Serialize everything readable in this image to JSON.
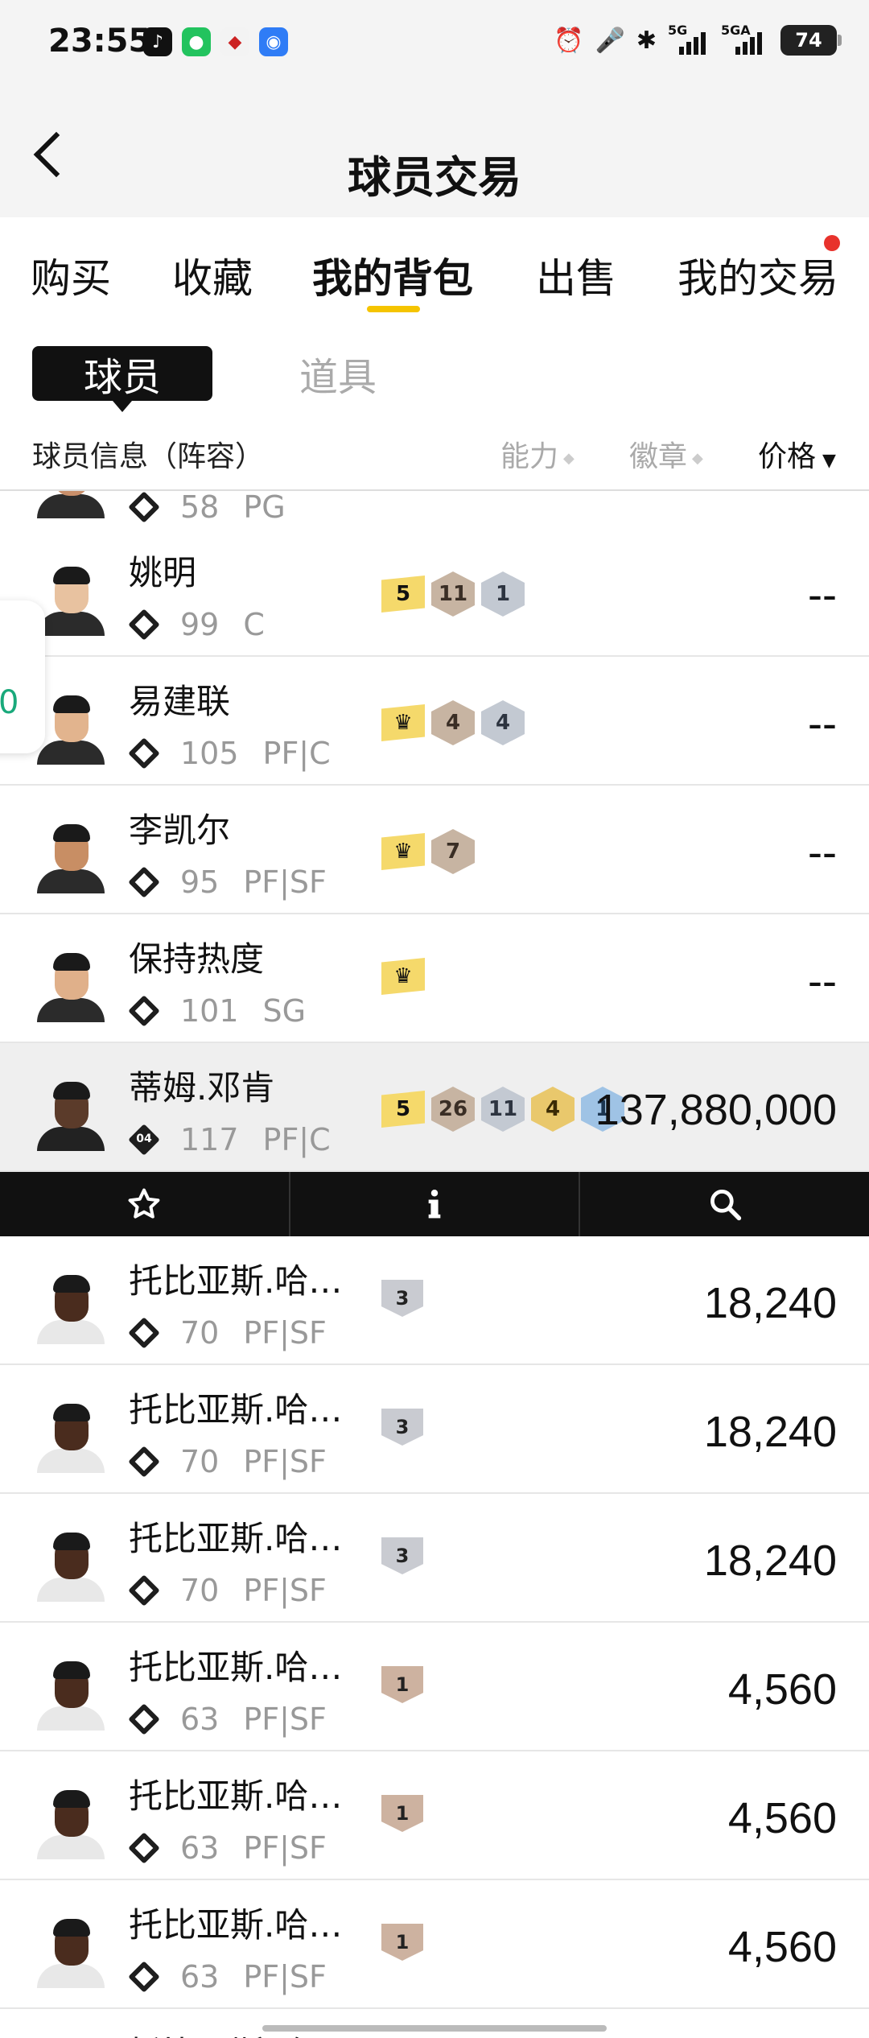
{
  "status_bar": {
    "time": "23:55",
    "apps": [
      "tiktok-icon",
      "wechat-icon",
      "game-app-icon",
      "radio-icon"
    ],
    "network_1": "5G",
    "network_2": "5GA",
    "battery": "74"
  },
  "header": {
    "title": "球员交易"
  },
  "tabs": [
    {
      "label": "购买"
    },
    {
      "label": "收藏"
    },
    {
      "label": "我的背包",
      "active": true
    },
    {
      "label": "出售"
    },
    {
      "label": "我的交易",
      "has_dot": true
    }
  ],
  "segments": {
    "player": "球员",
    "item": "道具"
  },
  "columns": {
    "info": "球员信息（阵容）",
    "ability": "能力",
    "badge": "徽章",
    "price": "价格"
  },
  "side_tab_text": "0",
  "players": [
    {
      "name": "",
      "rating": "58",
      "position": "PG",
      "price": "",
      "skin": "#c98f6a"
    },
    {
      "name": "姚明",
      "rating": "99",
      "position": "C",
      "price": "--",
      "skin": "#e8c2a0",
      "badges": [
        {
          "kind": "lvl",
          "v": "5"
        },
        {
          "kind": "bronze",
          "v": "11"
        },
        {
          "kind": "silver",
          "v": "1"
        }
      ]
    },
    {
      "name": "易建联",
      "rating": "105",
      "position": "PF|C",
      "price": "--",
      "skin": "#e2b48e",
      "badges": [
        {
          "kind": "crown",
          "v": "♛"
        },
        {
          "kind": "bronze",
          "v": "4"
        },
        {
          "kind": "silver",
          "v": "4"
        }
      ]
    },
    {
      "name": "李凯尔",
      "rating": "95",
      "position": "PF|SF",
      "price": "--",
      "skin": "#c88e64",
      "badges": [
        {
          "kind": "crown",
          "v": "♛"
        },
        {
          "kind": "bronze",
          "v": "7"
        }
      ]
    },
    {
      "name": "保持热度",
      "rating": "101",
      "position": "SG",
      "price": "--",
      "skin": "#e0b08a",
      "badges": [
        {
          "kind": "crown",
          "v": "♛"
        }
      ]
    },
    {
      "name": "蒂姆.邓肯",
      "rating": "117",
      "position": "PF|C",
      "price": "137,880,000",
      "skin": "#5b3b2a",
      "rank_label": "04",
      "badges": [
        {
          "kind": "lvl",
          "v": "5"
        },
        {
          "kind": "bronze",
          "v": "26"
        },
        {
          "kind": "silver",
          "v": "11"
        },
        {
          "kind": "gold",
          "v": "4"
        },
        {
          "kind": "blue",
          "v": "1"
        }
      ]
    },
    {
      "name": "托比亚斯.哈…",
      "rating": "70",
      "position": "PF|SF",
      "price": "18,240",
      "skin": "#4a2c1e",
      "badges": [
        {
          "kind": "shield-silver",
          "v": "3"
        }
      ]
    },
    {
      "name": "托比亚斯.哈…",
      "rating": "70",
      "position": "PF|SF",
      "price": "18,240",
      "skin": "#4a2c1e",
      "badges": [
        {
          "kind": "shield-silver",
          "v": "3"
        }
      ]
    },
    {
      "name": "托比亚斯.哈…",
      "rating": "70",
      "position": "PF|SF",
      "price": "18,240",
      "skin": "#4a2c1e",
      "badges": [
        {
          "kind": "shield-silver",
          "v": "3"
        }
      ]
    },
    {
      "name": "托比亚斯.哈…",
      "rating": "63",
      "position": "PF|SF",
      "price": "4,560",
      "skin": "#4a2c1e",
      "badges": [
        {
          "kind": "shield-bronze",
          "v": "1"
        }
      ]
    },
    {
      "name": "托比亚斯.哈…",
      "rating": "63",
      "position": "PF|SF",
      "price": "4,560",
      "skin": "#4a2c1e",
      "badges": [
        {
          "kind": "shield-bronze",
          "v": "1"
        }
      ]
    },
    {
      "name": "托比亚斯.哈…",
      "rating": "63",
      "position": "PF|SF",
      "price": "4,560",
      "skin": "#4a2c1e",
      "badges": [
        {
          "kind": "shield-bronze",
          "v": "1"
        }
      ]
    },
    {
      "name": "托比亚斯.哈…",
      "rating": "",
      "position": "",
      "price": "",
      "skin": "#4a2c1e"
    }
  ],
  "action_bar": [
    "star-icon",
    "info-icon",
    "search-icon"
  ],
  "colors": {
    "accent": "#f5c400",
    "dot": "#e8322c",
    "highlight_row": "#efefef"
  }
}
